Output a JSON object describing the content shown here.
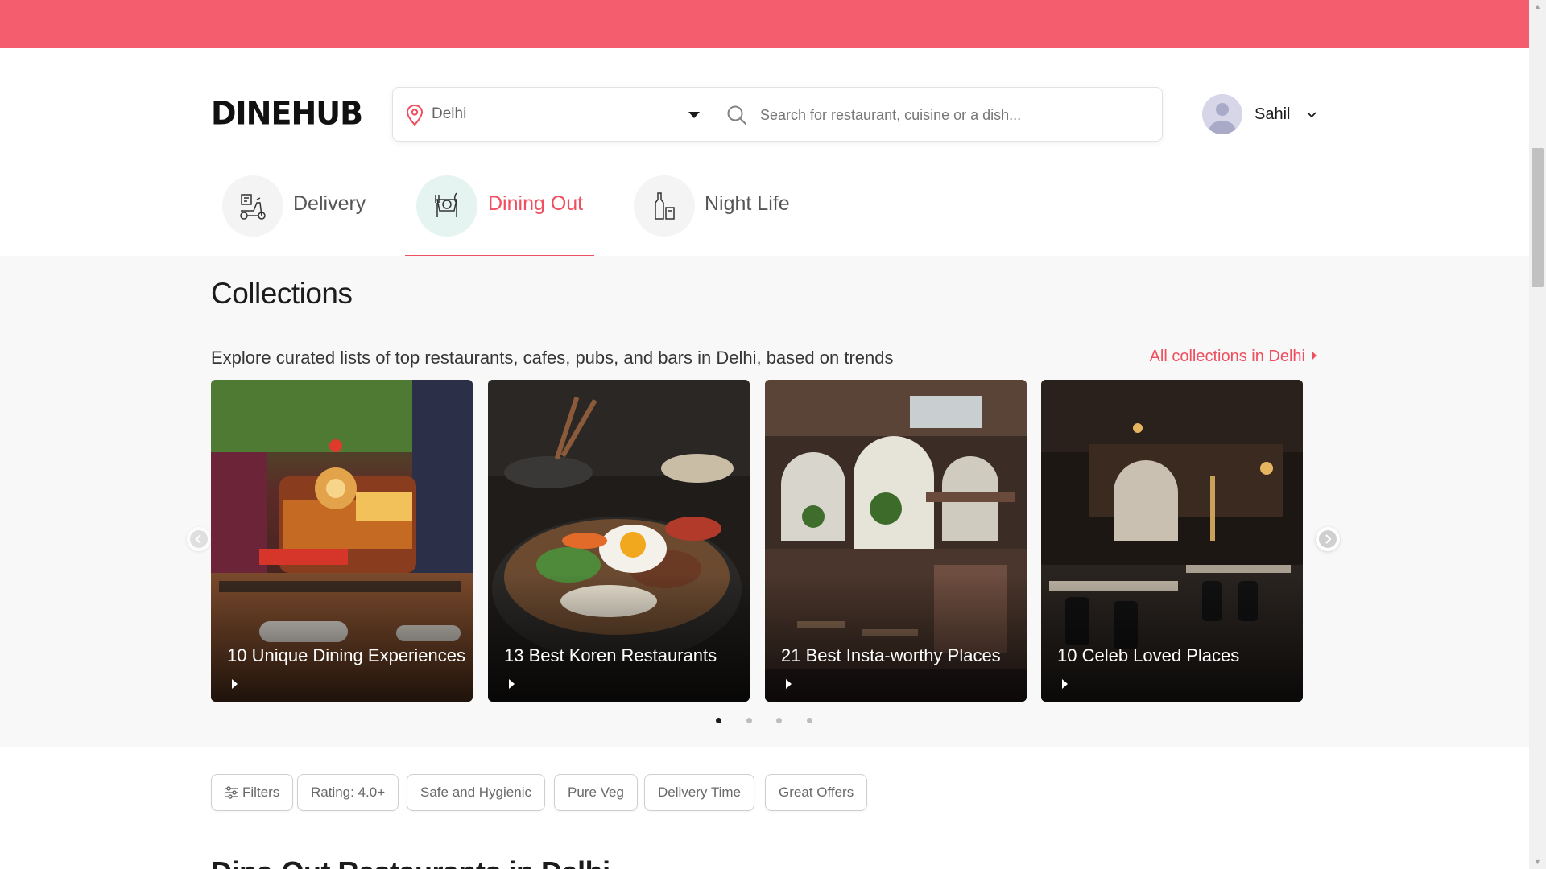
{
  "brand": {
    "logo": "DINEHUB",
    "accent_color": "#ef4f5f",
    "banner_color": "#f35d6d"
  },
  "search": {
    "location": "Delhi",
    "placeholder": "Search for restaurant, cuisine or a dish...",
    "location_icon": "location-pin-icon",
    "search_icon": "magnifier-icon"
  },
  "user": {
    "name": "Sahil",
    "avatar_icon": "user-avatar-icon"
  },
  "tabs": [
    {
      "label": "Delivery",
      "icon": "scooter-icon",
      "active": false
    },
    {
      "label": "Dining Out",
      "icon": "dining-plate-icon",
      "active": true
    },
    {
      "label": "Night Life",
      "icon": "bottle-glass-icon",
      "active": false
    }
  ],
  "collections": {
    "title": "Collections",
    "subtitle": "Explore curated lists of top restaurants, cafes, pubs, and bars in Delhi, based on trends",
    "all_link": "All collections in Delhi",
    "cards": [
      {
        "title": "10 Unique Dining Experiences"
      },
      {
        "title": "13 Best Koren Restaurants"
      },
      {
        "title": "21 Best Insta-worthy Places"
      },
      {
        "title": "10 Celeb Loved Places"
      }
    ],
    "pagination": {
      "pages": 4,
      "current": 1
    }
  },
  "filters": [
    {
      "label": "Filters",
      "icon": "sliders-icon"
    },
    {
      "label": "Rating: 4.0+"
    },
    {
      "label": "Safe and Hygienic"
    },
    {
      "label": "Pure Veg"
    },
    {
      "label": "Delivery Time"
    },
    {
      "label": "Great Offers"
    }
  ],
  "section_heading": "Dine-Out Restaurants in Delhi"
}
